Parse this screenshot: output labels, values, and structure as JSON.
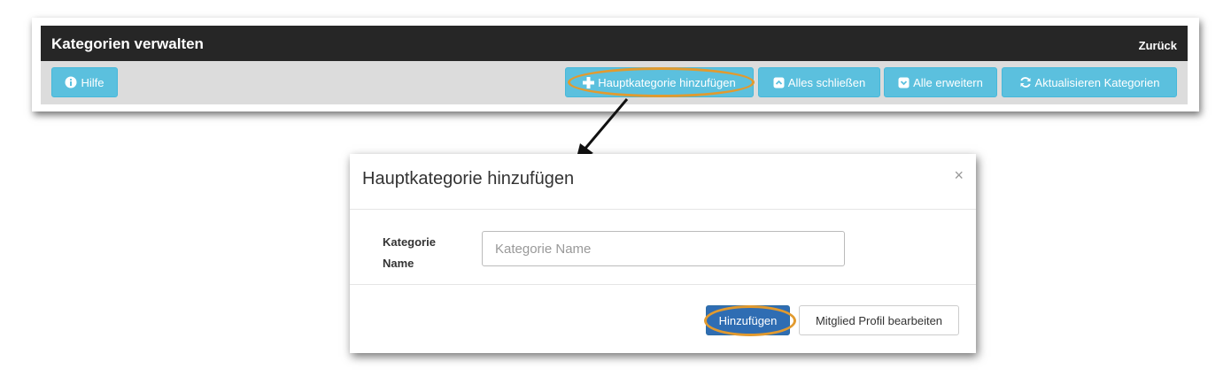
{
  "panel": {
    "title": "Kategorien verwalten",
    "back_label": "Zurück"
  },
  "toolbar": {
    "help_label": "Hilfe",
    "add_main_category_label": "Hauptkategorie hinzufügen",
    "collapse_all_label": "Alles schließen",
    "expand_all_label": "Alle erweitern",
    "refresh_label": "Aktualisieren Kategorien"
  },
  "modal": {
    "title": "Hauptkategorie hinzufügen",
    "close_symbol": "×",
    "field_label_line1": "Kategorie",
    "field_label_line2": "Name",
    "field_placeholder": "Kategorie Name",
    "field_value": "",
    "submit_label": "Hinzufügen",
    "secondary_label": "Mitglied Profil bearbeiten"
  },
  "icons": {
    "help": "info-circle-icon",
    "add": "plus-icon",
    "collapse": "collapse-square-icon",
    "expand": "expand-square-icon",
    "refresh": "refresh-icon"
  },
  "colors": {
    "header_bg": "#262626",
    "toolbar_bg": "#dcdcdc",
    "info_button": "#5bc0de",
    "primary_button": "#2f6db3",
    "highlight": "#e29a2e"
  }
}
